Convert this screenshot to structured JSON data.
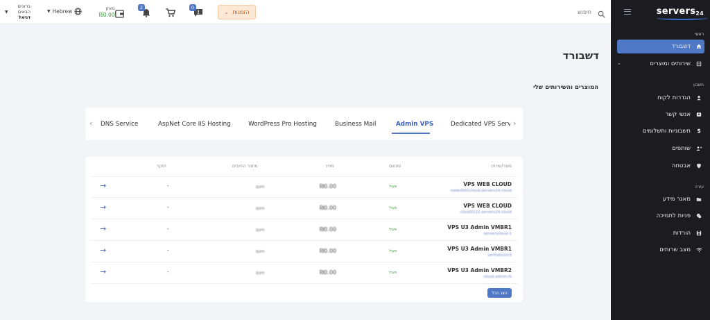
{
  "sidebar": {
    "logo_main": "servers",
    "logo_num": "24",
    "sections": {
      "main": "ראשי",
      "account": "חשבון",
      "help": "עזרה"
    },
    "items": [
      {
        "label": "דשבורד",
        "icon": "home-icon"
      },
      {
        "label": "שירותים ומוצרים",
        "icon": "box-icon"
      },
      {
        "label": "הגדרות לקוח",
        "icon": "user-icon"
      },
      {
        "label": "אנשי קשר",
        "icon": "contacts-icon"
      },
      {
        "label": "חשבוניות ותשלומים",
        "icon": "dollar-icon"
      },
      {
        "label": "שותפים",
        "icon": "partners-icon"
      },
      {
        "label": "אבטחה",
        "icon": "shield-icon"
      },
      {
        "label": "מאגר מידע",
        "icon": "folder-icon"
      },
      {
        "label": "פניות לתמיכה",
        "icon": "support-icon"
      },
      {
        "label": "הורדות",
        "icon": "save-icon"
      },
      {
        "label": "מצב שרותים",
        "icon": "wifi-icon"
      }
    ]
  },
  "topbar": {
    "search_placeholder": "חיפוש",
    "orders_label": "הזמנות",
    "notifications_count": "0",
    "cart_count": "2",
    "wallet_label": "מאזן",
    "wallet_amount": "₪0.00",
    "language": "Hebrew",
    "user_greeting_1": "ברוכים",
    "user_greeting_2": "הבאים",
    "user_name": "דניאל"
  },
  "main": {
    "page_title": "דשבורד",
    "section_title": "המוצרים והשירותים שלי",
    "tabs": [
      {
        "label": "Dedicated VPS Serve"
      },
      {
        "label": "Admin VPS"
      },
      {
        "label": "Business Mail"
      },
      {
        "label": "WordPress Pro Hosting"
      },
      {
        "label": "AspNet Core IIS Hosting"
      },
      {
        "label": "DNS Service"
      }
    ],
    "table": {
      "headers": {
        "product": "מוצר/שירות",
        "status": "סטטוס",
        "price": "מחיר",
        "cycle": "מחזור החיובים",
        "expiry": "תוקף"
      },
      "rows": [
        {
          "name": "VPS WEB CLOUD",
          "sub": "node3001cloud.servers24.cloud",
          "status": "פעיל",
          "price": "₪0.00",
          "cycle": "חינם",
          "expiry": "-"
        },
        {
          "name": "VPS WEB CLOUD",
          "sub": "cloud3122.servers24.cloud",
          "status": "פעיל",
          "price": "₪0.00",
          "cycle": "חינם",
          "expiry": "-"
        },
        {
          "name": "VPS U3 Admin VMBR1",
          "sub": "serverscloud-1",
          "status": "פעיל",
          "price": "₪0.00",
          "cycle": "חינם",
          "expiry": "-"
        },
        {
          "name": "VPS U3 Admin VMBR1",
          "sub": "serfnetcom3",
          "status": "פעיל",
          "price": "₪0.00",
          "cycle": "חינם",
          "expiry": "-"
        },
        {
          "name": "VPS U3 Admin VMBR2",
          "sub": "cloud-admin-fs",
          "status": "פעיל",
          "price": "₪0.00",
          "cycle": "חינם",
          "expiry": "-"
        }
      ],
      "show_all_label": "הצג הכל"
    }
  },
  "colors": {
    "accent": "#4f79c7",
    "sidebar_bg": "#1c1c20",
    "status_active": "#3e9c3e",
    "orders_bg": "#fde8d6"
  }
}
